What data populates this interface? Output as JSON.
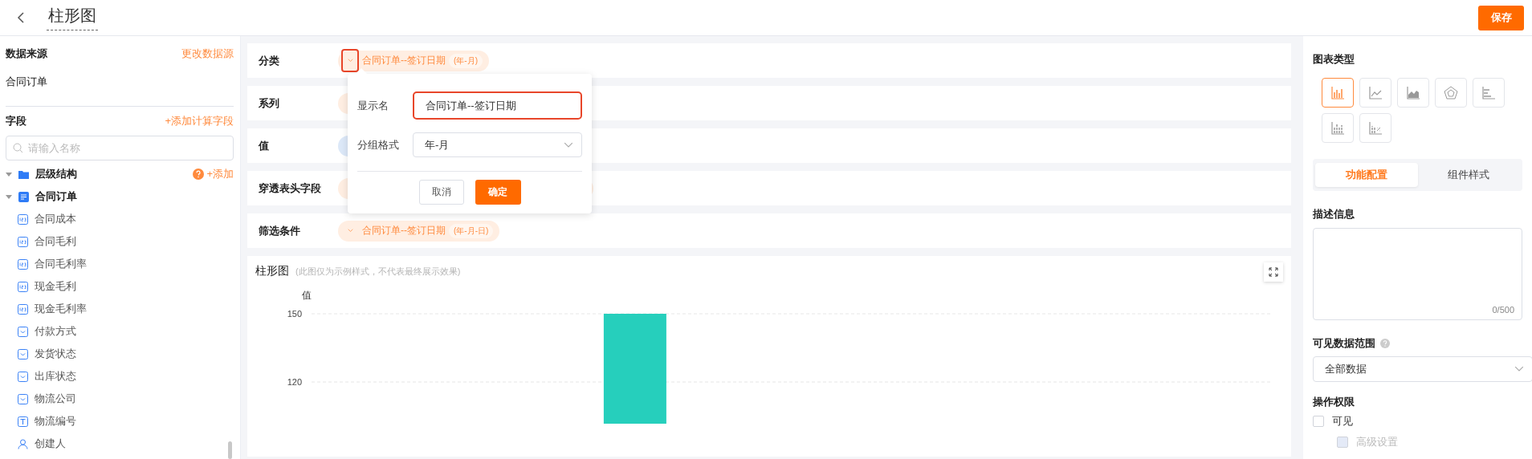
{
  "header": {
    "title": "柱形图",
    "save": "保存"
  },
  "sidebar": {
    "source_label": "数据来源",
    "change_source": "更改数据源",
    "source": "合同订单",
    "fields_label": "字段",
    "add_calc": "+添加计算字段",
    "search": {
      "placeholder": "请输入名称"
    },
    "tree": [
      {
        "label": "层级结构",
        "kind": "folder",
        "expanded": true,
        "action": "+添加"
      },
      {
        "label": "合同订单",
        "kind": "table",
        "expanded": true,
        "children": [
          {
            "label": "合同成本",
            "kind": "number"
          },
          {
            "label": "合同毛利",
            "kind": "number"
          },
          {
            "label": "合同毛利率",
            "kind": "number"
          },
          {
            "label": "现金毛利",
            "kind": "number"
          },
          {
            "label": "现金毛利率",
            "kind": "number"
          },
          {
            "label": "付款方式",
            "kind": "select"
          },
          {
            "label": "发货状态",
            "kind": "select"
          },
          {
            "label": "出库状态",
            "kind": "select"
          },
          {
            "label": "物流公司",
            "kind": "select"
          },
          {
            "label": "物流编号",
            "kind": "text"
          },
          {
            "label": "创建人",
            "kind": "user"
          }
        ]
      }
    ]
  },
  "config_rows": [
    {
      "label": "分类",
      "chip": {
        "kind": "dimension",
        "text": "合同订单--签订日期",
        "format": "(年-月)",
        "highlighted": true
      }
    },
    {
      "label": "系列",
      "chip": {
        "kind": "dimension"
      }
    },
    {
      "label": "值",
      "chip": {
        "kind": "measure"
      }
    },
    {
      "label": "穿透表头字段",
      "chip": {
        "kind": "dimension"
      }
    },
    {
      "label": "筛选条件",
      "chip": {
        "kind": "dimension",
        "text": "合同订单--签订日期",
        "format": "(年-月-日)",
        "highlighted": false
      }
    }
  ],
  "popover": {
    "name_label": "显示名",
    "name_value": "合同订单--签订日期",
    "format_label": "分组格式",
    "format_value": "年-月",
    "cancel": "取消",
    "confirm": "确定"
  },
  "chart_card": {
    "title": "柱形图",
    "note": "(此图仅为示例样式，不代表最终展示效果)",
    "chart_data": {
      "type": "bar",
      "ylabel": "值",
      "ylim": [
        90,
        150
      ],
      "yticks": [
        120,
        150
      ],
      "series": [
        {
          "color": "#26cfbc",
          "values": [
            150
          ]
        }
      ]
    }
  },
  "panel": {
    "chart_type_label": "图表类型",
    "chart_types": [
      {
        "kind": "bar",
        "selected": true
      },
      {
        "kind": "line",
        "selected": false
      },
      {
        "kind": "area",
        "selected": false
      },
      {
        "kind": "radar",
        "selected": false
      },
      {
        "kind": "hbar",
        "selected": false
      },
      {
        "kind": "stacked",
        "selected": false
      },
      {
        "kind": "percent",
        "selected": false
      }
    ],
    "tabs": [
      {
        "label": "功能配置",
        "selected": true
      },
      {
        "label": "组件样式",
        "selected": false
      }
    ],
    "desc_label": "描述信息",
    "desc_counter": "0/500",
    "range_label": "可见数据范围",
    "range_value": "全部数据",
    "perm_label": "操作权限",
    "perms": [
      {
        "label": "可见",
        "checked": false,
        "disabled": false,
        "children": [
          {
            "label": "高级设置",
            "checked": false,
            "disabled": true
          }
        ]
      }
    ]
  }
}
